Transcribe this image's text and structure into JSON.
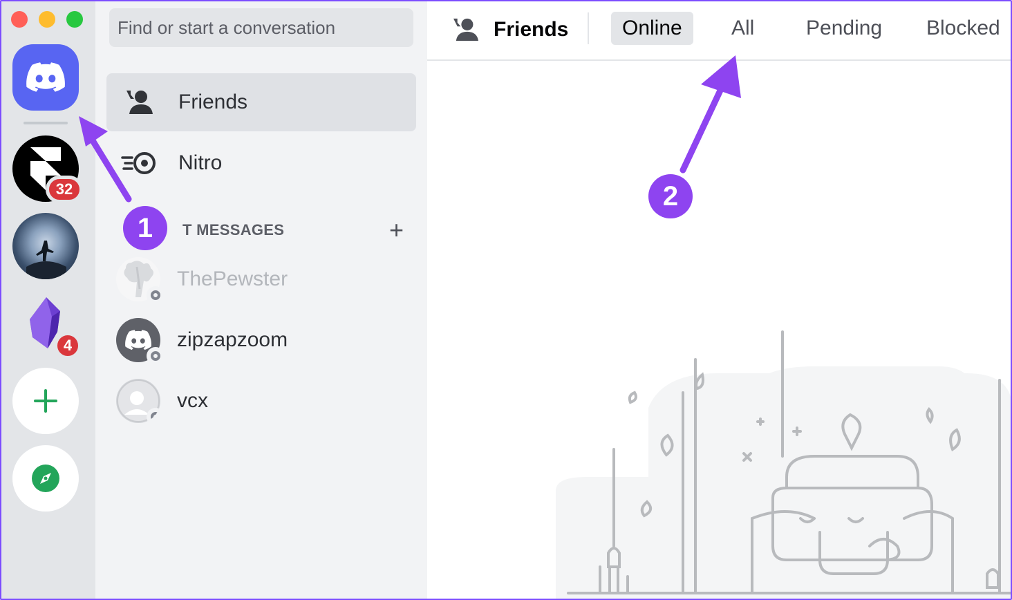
{
  "search": {
    "placeholder": "Find or start a conversation"
  },
  "sidebar": {
    "items": [
      {
        "label": "Friends",
        "icon": "friends-icon"
      },
      {
        "label": "Nitro",
        "icon": "nitro-icon"
      }
    ],
    "dm_header": "T MESSAGES",
    "dm_header_add": "+",
    "dms": [
      {
        "name": "ThePewster"
      },
      {
        "name": "zipzapzoom"
      },
      {
        "name": "vcx"
      }
    ]
  },
  "servers": {
    "badges": [
      "32",
      "4"
    ]
  },
  "topbar": {
    "title": "Friends",
    "tabs": [
      "Online",
      "All",
      "Pending",
      "Blocked"
    ]
  },
  "annotations": {
    "step1": "1",
    "step2": "2"
  },
  "colors": {
    "brand": "#5865f2",
    "annotation": "#8e44f0",
    "badge": "#da373c",
    "add_green": "#23a55a"
  }
}
